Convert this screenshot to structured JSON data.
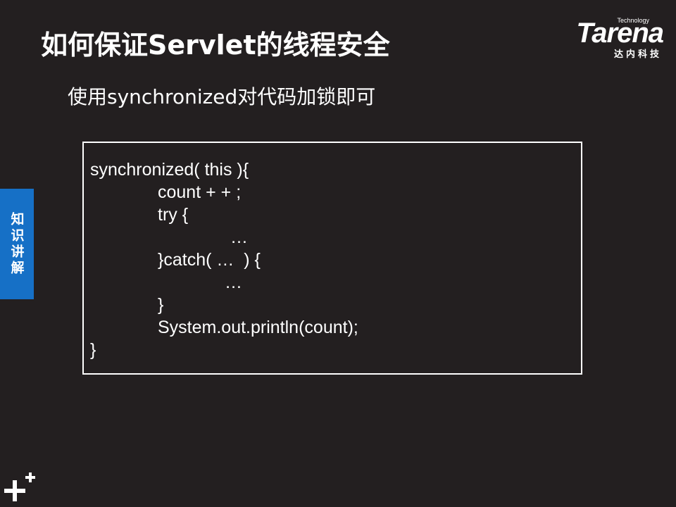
{
  "slide": {
    "title": "如何保证Servlet的线程安全",
    "subtitle": "使用synchronized对代码加锁即可",
    "side_tab": "知识讲解"
  },
  "brand": {
    "word": "Tarena",
    "tech": "Technology",
    "cn": "达内科技"
  },
  "code_lines": [
    "synchronized( this ){",
    "count + + ;",
    "try {",
    "…",
    "}catch( …  ) {",
    "…",
    "}",
    "System.out.println(count);",
    "}"
  ],
  "colors": {
    "background": "#231f20",
    "side_tab": "#1670c6",
    "text": "#ffffff"
  }
}
